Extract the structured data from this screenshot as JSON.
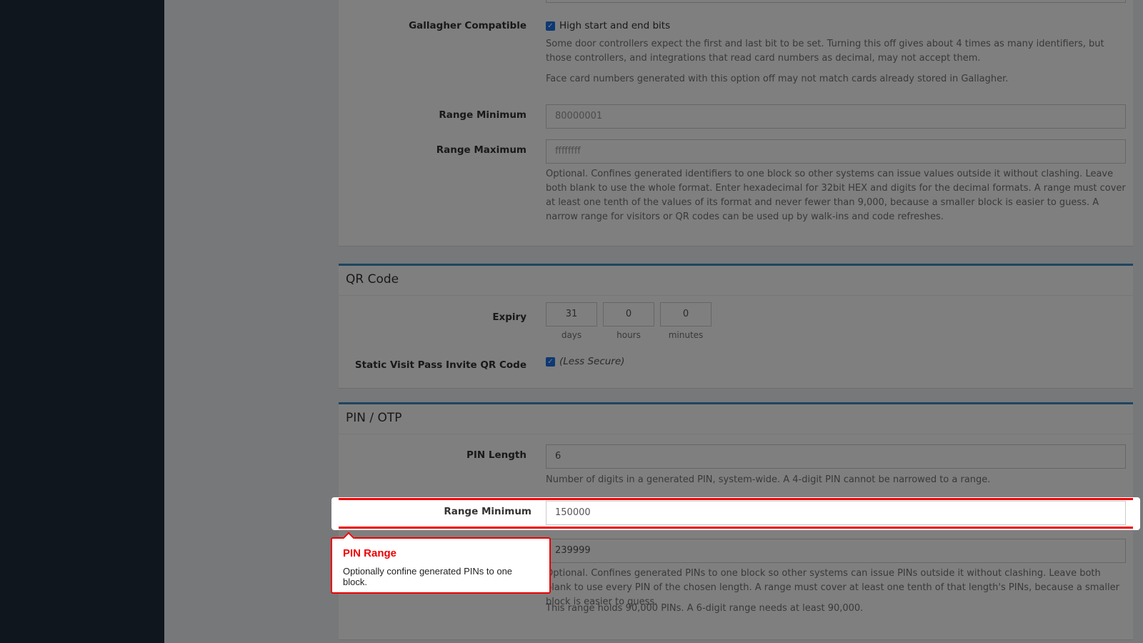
{
  "card": {
    "gallagher": {
      "label": "Gallagher Compatible",
      "checkbox_label": "High start and end bits",
      "checked": true,
      "help1": "Some door controllers expect the first and last bit to be set. Turning this off gives about 4 times as many identifiers, but those controllers, and integrations that read card numbers as decimal, may not accept them.",
      "help2": "Face card numbers generated with this option off may not match cards already stored in Gallagher."
    },
    "range_min": {
      "label": "Range Minimum",
      "placeholder": "80000001"
    },
    "range_max": {
      "label": "Range Maximum",
      "placeholder": "ffffffff"
    },
    "range_help": "Optional. Confines generated identifiers to one block so other systems can issue values outside it without clashing. Leave both blank to use the whole format. Enter hexadecimal for 32bit HEX and digits for the decimal formats. A range must cover at least one tenth of the values of its format and never fewer than 9,000, because a smaller block is easier to guess. A narrow range for visitors or QR codes can be used up by walk-ins and code refreshes."
  },
  "qr": {
    "title": "QR Code",
    "expiry": {
      "label": "Expiry",
      "days": "31",
      "hours": "0",
      "minutes": "0",
      "days_label": "days",
      "hours_label": "hours",
      "minutes_label": "minutes"
    },
    "static": {
      "label": "Static Visit Pass Invite QR Code",
      "checked": true,
      "note": "(Less Secure)"
    }
  },
  "pin": {
    "title": "PIN / OTP",
    "length": {
      "label": "PIN Length",
      "value": "6",
      "help": "Number of digits in a generated PIN, system-wide. A 4-digit PIN cannot be narrowed to a range."
    },
    "range_min": {
      "label": "Range Minimum",
      "value": "150000"
    },
    "range_max": {
      "value": "239999"
    },
    "help1": "Optional. Confines generated PINs to one block so other systems can issue PINs outside it without clashing. Leave both blank to use every PIN of the chosen length. A range must cover at least one tenth of that length's PINs, because a smaller block is easier to guess.",
    "help2": "This range holds 90,000 PINs. A 6-digit range needs at least 90,000."
  },
  "tooltip": {
    "title": "PIN Range",
    "body": "Optionally confine generated PINs to one block."
  },
  "colors": {
    "accent": "#3c8dbc",
    "highlight": "#e00000",
    "sidebar": "#1f2d3a"
  }
}
